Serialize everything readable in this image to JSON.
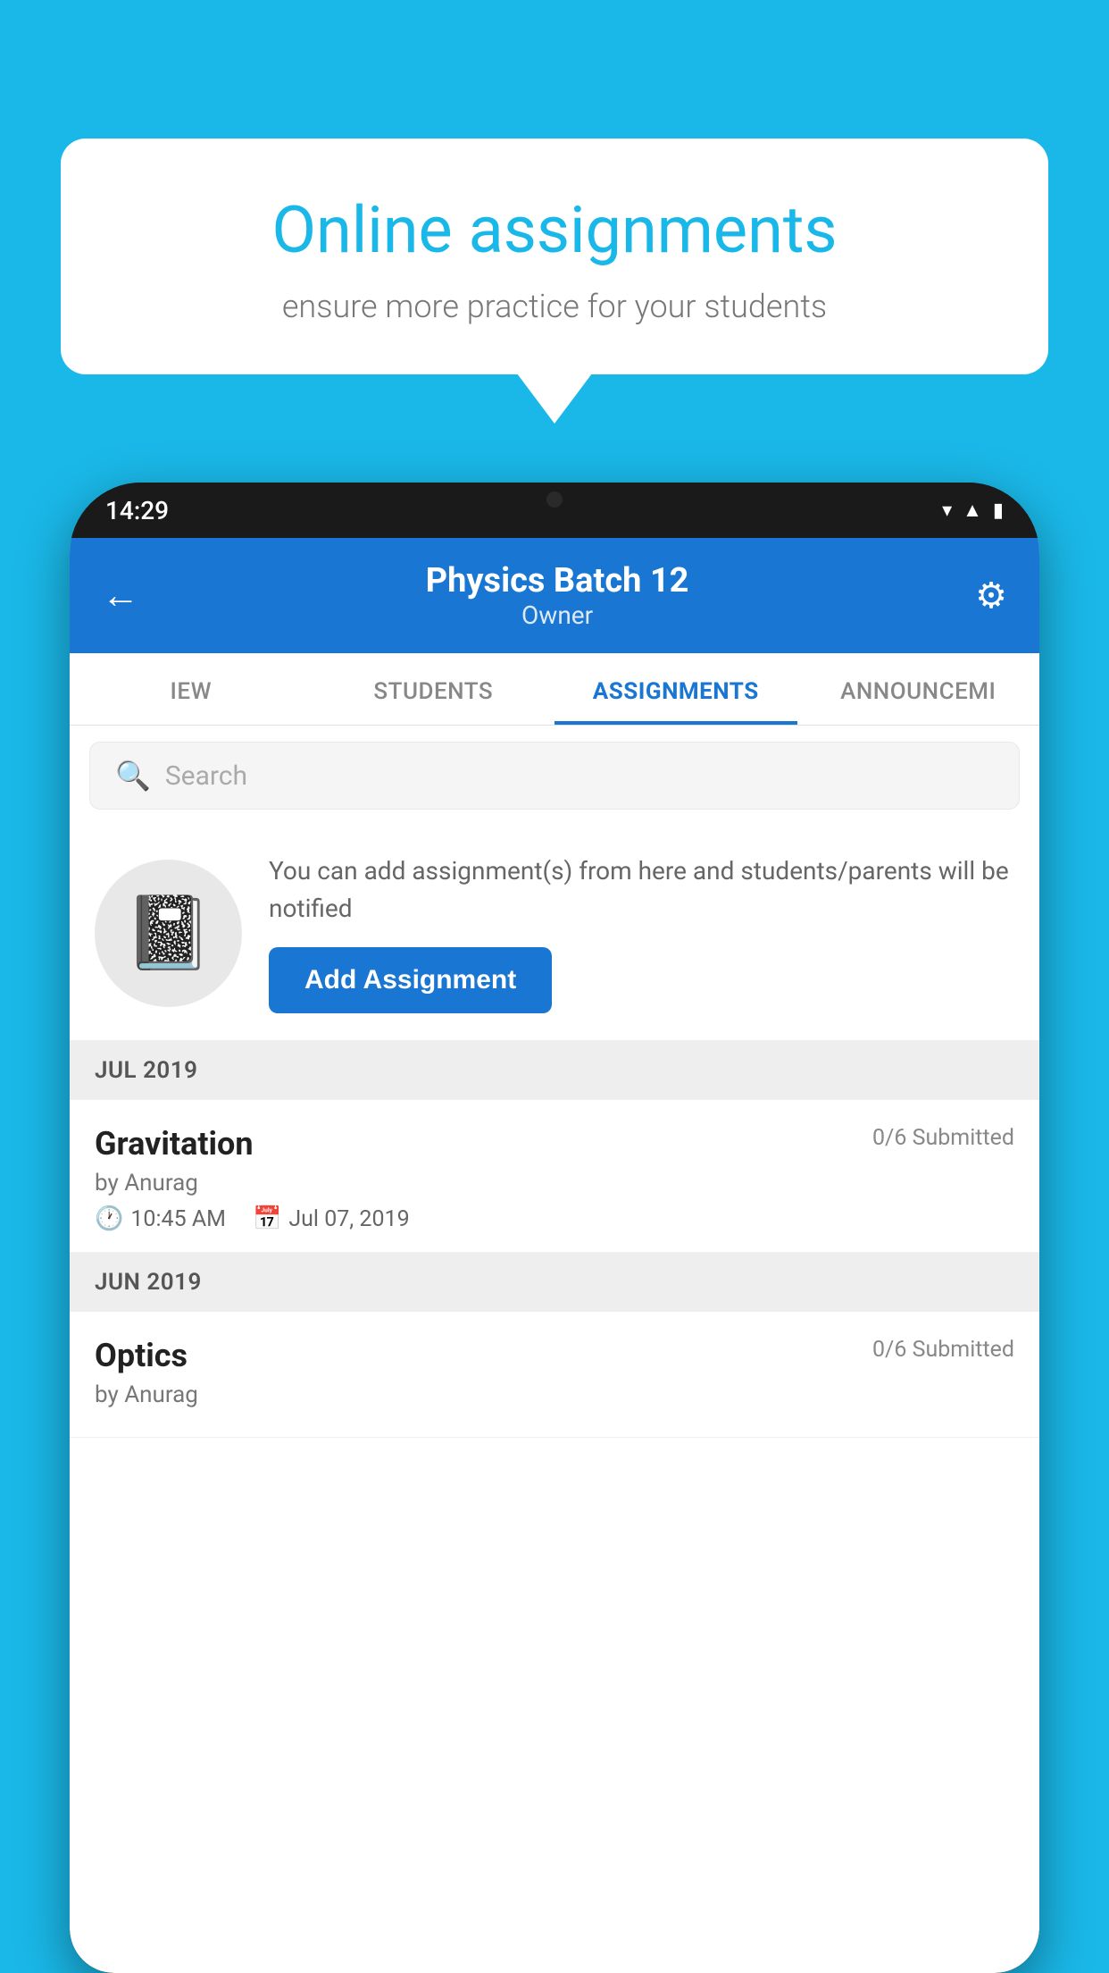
{
  "background_color": "#1ab8e8",
  "bubble": {
    "title": "Online assignments",
    "subtitle": "ensure more practice for your students"
  },
  "phone": {
    "status_bar": {
      "time": "14:29",
      "icons": [
        "wifi",
        "signal",
        "battery"
      ]
    },
    "app_bar": {
      "title": "Physics Batch 12",
      "subtitle": "Owner",
      "back_label": "←",
      "settings_label": "⚙"
    },
    "tabs": [
      {
        "label": "IEW",
        "active": false
      },
      {
        "label": "STUDENTS",
        "active": false
      },
      {
        "label": "ASSIGNMENTS",
        "active": true
      },
      {
        "label": "ANNOUNCEMI",
        "active": false
      }
    ],
    "search": {
      "placeholder": "Search"
    },
    "add_assignment": {
      "description": "You can add assignment(s) from here and students/parents will be notified",
      "button_label": "Add Assignment"
    },
    "sections": [
      {
        "header": "JUL 2019",
        "items": [
          {
            "name": "Gravitation",
            "submitted": "0/6 Submitted",
            "author": "by Anurag",
            "time": "10:45 AM",
            "date": "Jul 07, 2019"
          }
        ]
      },
      {
        "header": "JUN 2019",
        "items": [
          {
            "name": "Optics",
            "submitted": "0/6 Submitted",
            "author": "by Anurag",
            "time": "",
            "date": ""
          }
        ]
      }
    ]
  }
}
